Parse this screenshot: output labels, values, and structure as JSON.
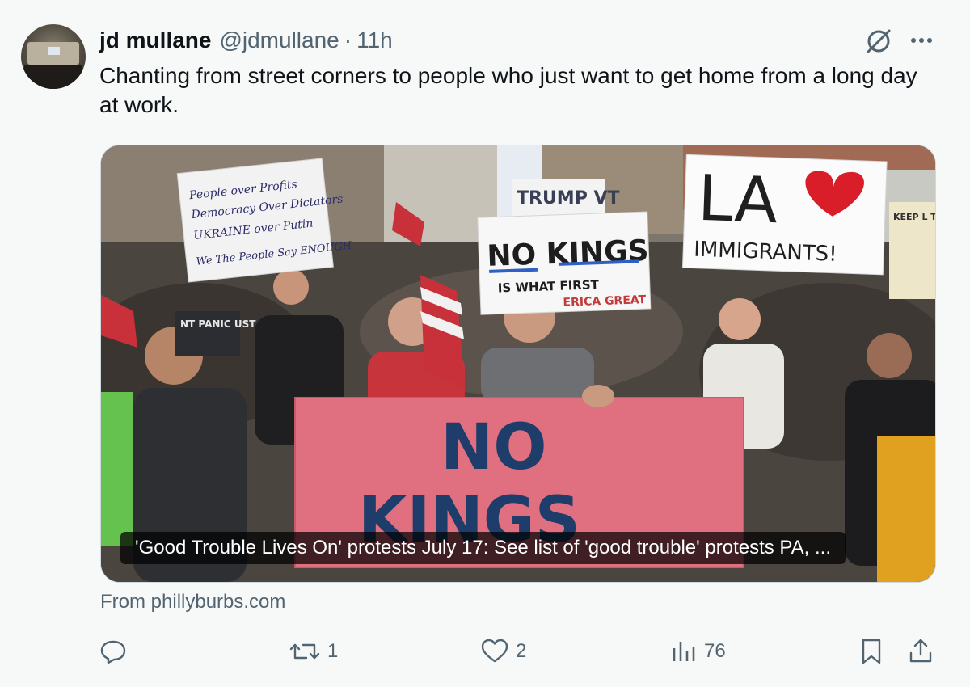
{
  "author": {
    "display_name": "jd mullane",
    "handle": "@jdmullane",
    "separator": "·",
    "time": "11h"
  },
  "tweet": {
    "text": "Chanting from street corners to people who just want to get home from a long day at work."
  },
  "link_card": {
    "title": "'Good Trouble Lives On' protests July 17: See list of 'good trouble' protests PA, ...",
    "source": "From phillyburbs.com",
    "image_signs": {
      "big_banner_line1": "NO",
      "big_banner_line2": "KINGS",
      "sign_left_lines": [
        "People over Profits",
        "Democracy Over Dictators",
        "UKRAINE over Putin",
        "We The People Say ENOUGH"
      ],
      "sign_center_line1": "NO KINGS",
      "sign_center_line2": "IS WHAT FIRST",
      "sign_center_line3": "ERICA GREAT",
      "sign_top_center": "TRUMP VT",
      "sign_right_line1": "LA",
      "sign_right_line2": "IMMIGRANTS!",
      "sign_far_right": "KEEP L TOW",
      "sign_left_small": "NT PANIC UST"
    }
  },
  "actions": {
    "replies": "",
    "retweets": "1",
    "likes": "2",
    "views": "76"
  },
  "icons": [
    "grok-icon",
    "more-icon",
    "reply-icon",
    "retweet-icon",
    "like-icon",
    "views-icon",
    "bookmark-icon",
    "share-icon"
  ],
  "colors": {
    "text": "#0f1419",
    "secondary": "#536471",
    "background": "#f7f9f9",
    "banner_red": "#e06a7a",
    "banner_text": "#1f3d6b"
  }
}
